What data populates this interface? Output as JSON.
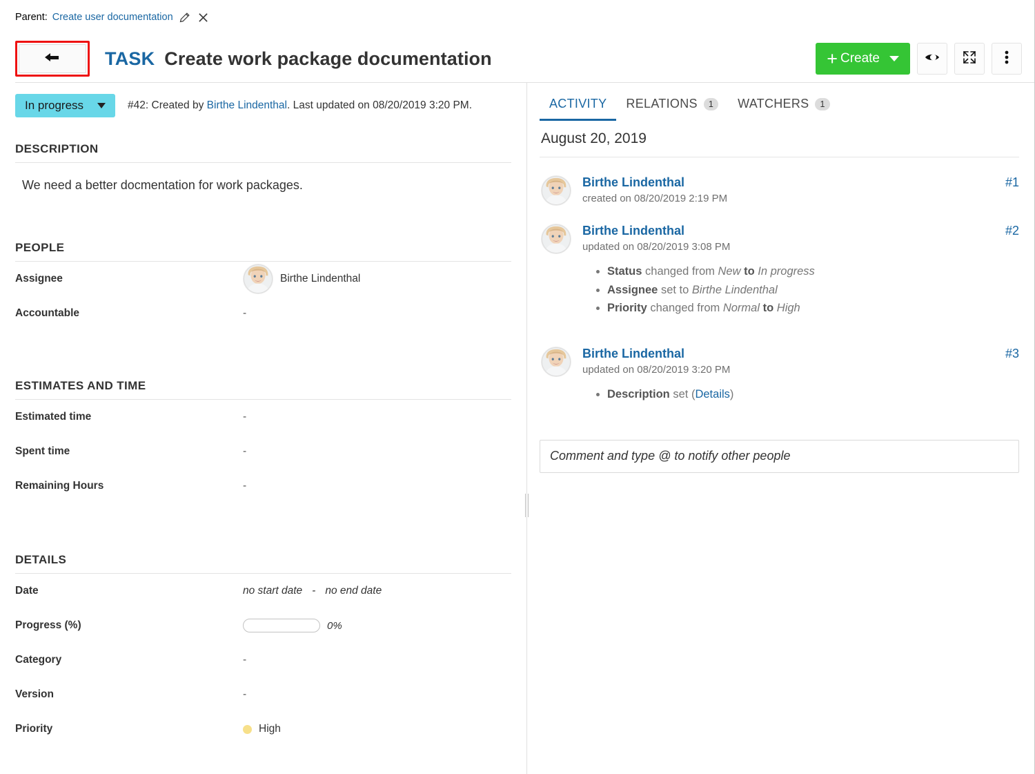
{
  "breadcrumb": {
    "label": "Parent:",
    "parent_link": "Create user documentation",
    "edit_icon": "pencil-icon",
    "close_icon": "close-icon"
  },
  "header": {
    "back_icon": "back-arrow-icon",
    "type": "TASK",
    "subject": "Create work package documentation",
    "create_label": "Create",
    "watch_icon": "eye-icon",
    "fullscreen_icon": "fullscreen-icon",
    "more_icon": "more-vertical-icon",
    "accent_green": "#35c535",
    "accent_blue": "#1a67a3",
    "highlight_red": "#ee1111"
  },
  "status": {
    "value": "In progress",
    "badge_color": "#68d7e8",
    "meta_prefix": "#42: Created by ",
    "meta_author": "Birthe Lindenthal",
    "meta_suffix": ". Last updated on 08/20/2019 3:20 PM."
  },
  "sections": {
    "description": {
      "title": "DESCRIPTION",
      "text": "We need a better docmentation for work packages."
    },
    "people": {
      "title": "PEOPLE",
      "rows": [
        {
          "label": "Assignee",
          "value": "Birthe Lindenthal",
          "has_avatar": true
        },
        {
          "label": "Accountable",
          "value": "-",
          "has_avatar": false
        }
      ]
    },
    "estimates": {
      "title": "ESTIMATES AND TIME",
      "rows": [
        {
          "label": "Estimated time",
          "value": "-"
        },
        {
          "label": "Spent time",
          "value": "-"
        },
        {
          "label": "Remaining Hours",
          "value": "-"
        }
      ]
    },
    "details": {
      "title": "DETAILS",
      "date_label": "Date",
      "date_start": "no start date",
      "date_sep": "-",
      "date_end": "no end date",
      "progress_label": "Progress (%)",
      "progress_value": "0%",
      "progress_percent": 0,
      "category_label": "Category",
      "category_value": "-",
      "version_label": "Version",
      "version_value": "-",
      "priority_label": "Priority",
      "priority_value": "High",
      "priority_color": "#f7e08a"
    }
  },
  "right": {
    "tabs": [
      {
        "label": "ACTIVITY",
        "count": "",
        "active": true
      },
      {
        "label": "RELATIONS",
        "count": "1",
        "active": false
      },
      {
        "label": "WATCHERS",
        "count": "1",
        "active": false
      }
    ],
    "activity_date": "August 20, 2019",
    "activities": [
      {
        "user": "Birthe Lindenthal",
        "time": "created on 08/20/2019 2:19 PM",
        "number": "#1",
        "changes": []
      },
      {
        "user": "Birthe Lindenthal",
        "time": "updated on 08/20/2019 3:08 PM",
        "number": "#2",
        "changes": [
          {
            "field": "Status",
            "mid": " changed from ",
            "from": "New",
            "joiner": " to ",
            "to": "In progress"
          },
          {
            "field": "Assignee",
            "mid": " set to ",
            "from": "",
            "joiner": "",
            "to": "Birthe Lindenthal"
          },
          {
            "field": "Priority",
            "mid": " changed from ",
            "from": "Normal",
            "joiner": " to ",
            "to": "High"
          }
        ]
      },
      {
        "user": "Birthe Lindenthal",
        "time": "updated on 08/20/2019 3:20 PM",
        "number": "#3",
        "changes": [
          {
            "field": "Description",
            "mid": " set (",
            "from": "",
            "joiner": "",
            "to": "Details",
            "link": true,
            "suffix": ")"
          }
        ]
      }
    ],
    "comment_placeholder": "Comment and type @ to notify other people"
  }
}
